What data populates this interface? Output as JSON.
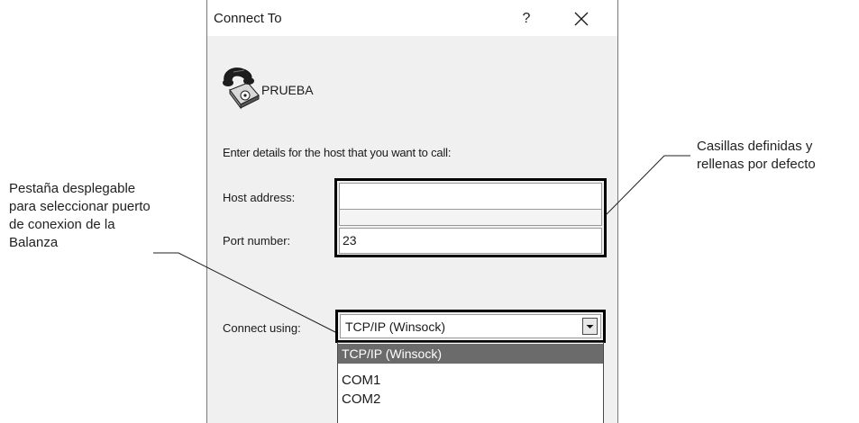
{
  "dialog": {
    "title": "Connect To",
    "help_label": "?",
    "connection_name": "PRUEBA",
    "prompt": "Enter details for the host that you want to call:",
    "host_address": {
      "label": "Host address:",
      "value": ""
    },
    "port_number": {
      "label": "Port number:",
      "value": "23"
    },
    "connect_using": {
      "label": "Connect using:",
      "selected": "TCP/IP (Winsock)",
      "options": [
        "TCP/IP (Winsock)",
        "COM1",
        "COM2"
      ]
    }
  },
  "annotations": {
    "left": [
      "Pestaña desplegable",
      "para seleccionar puerto",
      "de conexion de la",
      "Balanza"
    ],
    "right": [
      "Casillas definidas y",
      "rellenas por defecto"
    ]
  }
}
